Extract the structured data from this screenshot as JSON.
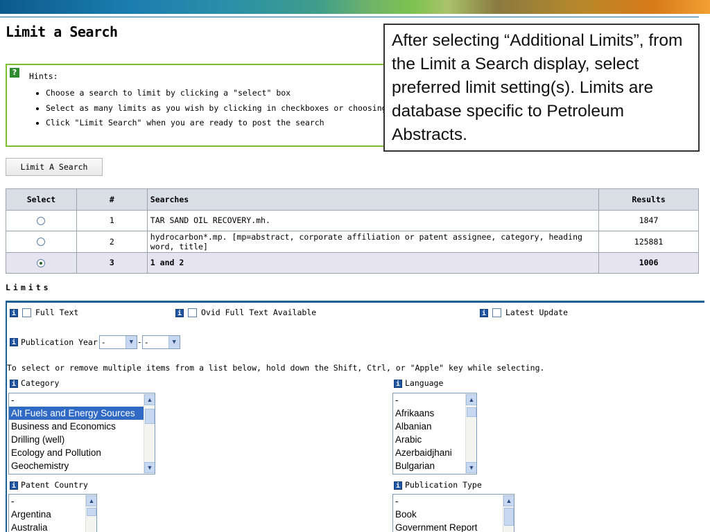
{
  "page": {
    "title": "Limit a Search"
  },
  "hints": {
    "title": "Hints:",
    "items": [
      "Choose a search to limit by clicking a \"select\" box",
      "Select as many limits as you wish by clicking in checkboxes or choosing from pull-d",
      "Click \"Limit Search\" when you are ready to post the search"
    ]
  },
  "callout": {
    "text": "After selecting “Additional Limits”, from the Limit a Search display, select preferred limit setting(s). Limits are database specific to Petroleum Abstracts."
  },
  "limit_button": {
    "label": "Limit A Search"
  },
  "searches_table": {
    "headers": [
      "Select",
      "#",
      "Searches",
      "Results"
    ],
    "rows": [
      {
        "num": "1",
        "search": "TAR SAND OIL RECOVERY.mh.",
        "results": "1847",
        "selected": false
      },
      {
        "num": "2",
        "search": "hydrocarbon*.mp. [mp=abstract, corporate affiliation or patent assignee, category, heading word, title]",
        "results": "125881",
        "selected": false
      },
      {
        "num": "3",
        "search": "1 and 2",
        "results": "1006",
        "selected": true
      }
    ]
  },
  "limits": {
    "label": "Limits",
    "full_text": "Full Text",
    "ovid_full_text": "Ovid Full Text Available",
    "latest_update": "Latest Update",
    "publication_year": "Publication Year",
    "year_from": "-",
    "year_to": "-",
    "multi_select_note": "To select or remove multiple items from a list below, hold down the Shift, Ctrl, or \"Apple\" key while selecting.",
    "category": {
      "label": "Category",
      "options": [
        "-",
        "Alt Fuels and Energy Sources",
        "Business and Economics",
        "Drilling (well)",
        "Ecology and Pollution",
        "Geochemistry"
      ],
      "selected_index": 1
    },
    "language": {
      "label": "Language",
      "options": [
        "-",
        "Afrikaans",
        "Albanian",
        "Arabic",
        "Azerbaidjhani",
        "Bulgarian"
      ]
    },
    "patent_country": {
      "label": "Patent Country",
      "options": [
        "-",
        "Argentina",
        "Australia"
      ]
    },
    "publication_type": {
      "label": "Publication Type",
      "options": [
        "-",
        "Book",
        "Government Report"
      ]
    }
  },
  "colors": {
    "hints_border": "#7cbf2c",
    "panel_border": "#1a5f96",
    "header_bg": "#d9dfe4",
    "selected_row_bg": "#e6e4f0",
    "list_selection": "#316ac5"
  }
}
